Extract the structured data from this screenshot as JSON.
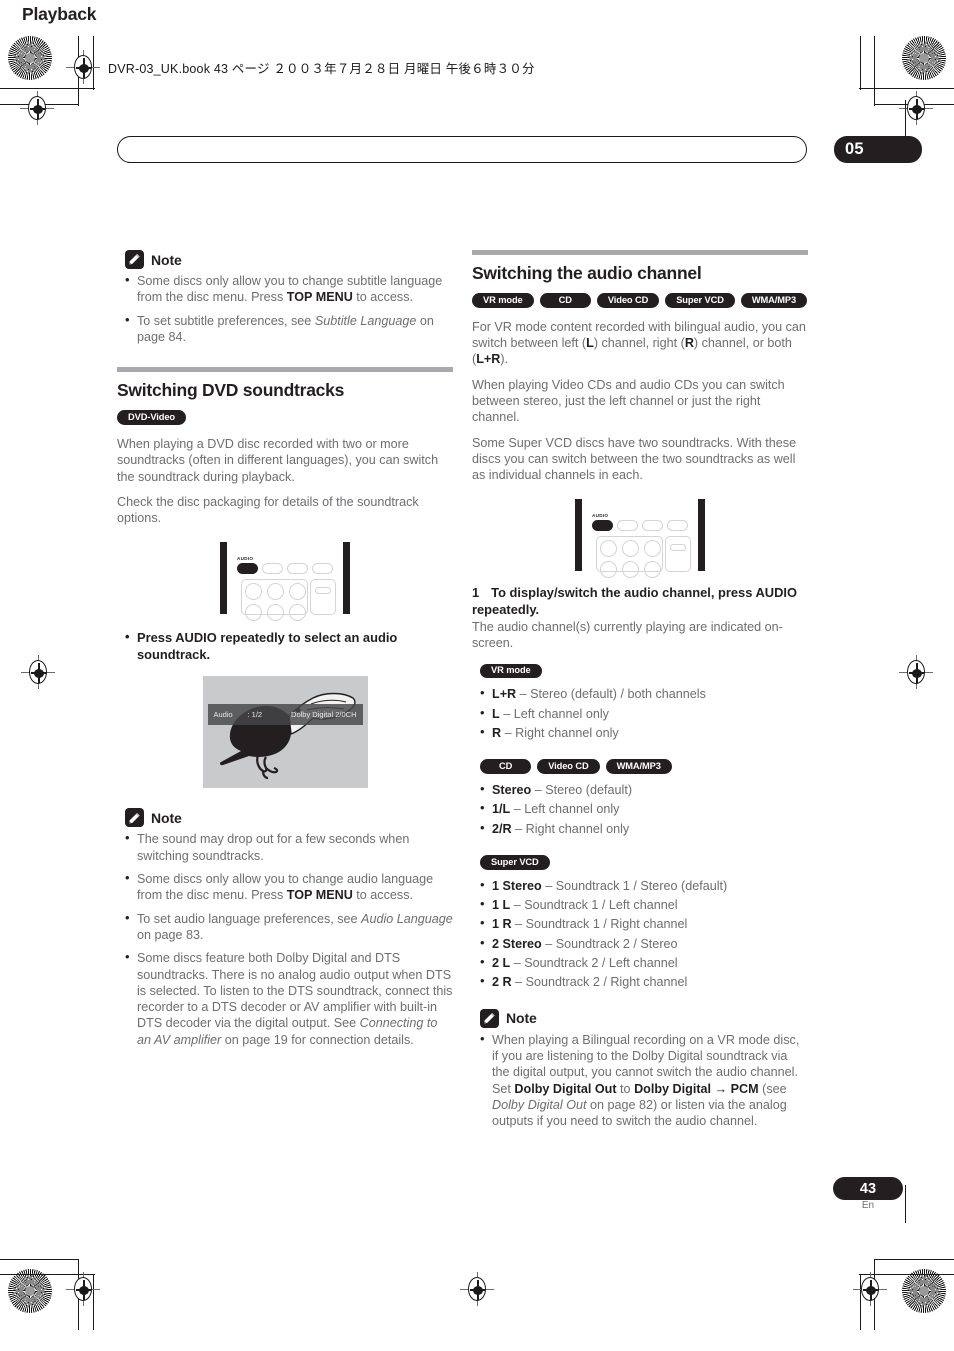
{
  "file_header": "DVR-03_UK.book 43 ページ ２００３年７月２８日 月曜日 午後６時３０分",
  "running_header": {
    "title": "Playback",
    "chapter": "05"
  },
  "footer": {
    "page_number": "43",
    "language": "En"
  },
  "left_column": {
    "note_top": {
      "label": "Note",
      "items": [
        "Some discs only allow you to change subtitle language from the disc menu. Press <b>TOP MENU</b> to access.",
        "To set subtitle preferences, see <i>Subtitle Language</i> on page 84."
      ]
    },
    "section": {
      "heading": "Switching DVD soundtracks",
      "badges": [
        "DVD-Video"
      ],
      "paragraphs": [
        "When playing a DVD disc recorded with two or more soundtracks (often in different languages), you can switch the soundtrack during playback.",
        "Check the disc packaging for details of the soundtrack options."
      ],
      "instruction": "Press AUDIO repeatedly to select an audio soundtrack."
    },
    "osd": {
      "label": "Audio",
      "value": ": 1/2",
      "format": "Dolby Digital 2/0CH"
    },
    "note_bottom": {
      "label": "Note",
      "items": [
        "The sound may drop out for a few seconds when switching soundtracks.",
        "Some discs only allow you to change audio language from the disc menu. Press <b>TOP MENU</b> to access.",
        "To set audio language preferences, see <i>Audio Language</i> on page 83.",
        "Some discs feature both Dolby Digital and DTS soundtracks. There is no analog audio output when DTS is selected. To listen to the DTS soundtrack, connect this recorder to a DTS decoder or AV amplifier with built-in DTS decoder via the digital output. See <i>Connecting to an AV amplifier</i> on page 19 for connection details."
      ]
    }
  },
  "right_column": {
    "section": {
      "heading": "Switching the audio channel",
      "badges": [
        "VR mode",
        "CD",
        "Video CD",
        "Super VCD",
        "WMA/MP3"
      ],
      "paragraphs": [
        "For VR mode content recorded with bilingual audio, you can switch between left (<b>L</b>) channel, right (<b>R</b>) channel, or both (<b>L+R</b>).",
        "When playing Video CDs and audio CDs you can switch between stereo, just the left channel or just the right channel.",
        "Some Super VCD discs have two soundtracks. With these discs you can switch between the two soundtracks as well as individual channels in each."
      ]
    },
    "step": {
      "number": "1",
      "title": "To display/switch the audio channel, press AUDIO repeatedly.",
      "detail": "The audio channel(s) currently playing are indicated on-screen."
    },
    "groups": [
      {
        "badges": [
          "VR mode"
        ],
        "items": [
          "<b>L+R</b> – Stereo (default) / both channels",
          "<b>L</b> – Left channel only",
          "<b>R</b> – Right channel only"
        ]
      },
      {
        "badges": [
          "CD",
          "Video CD",
          "WMA/MP3"
        ],
        "items": [
          "<b>Stereo</b> – Stereo (default)",
          "<b>1/L</b> – Left channel only",
          "<b>2/R</b> – Right channel only"
        ]
      },
      {
        "badges": [
          "Super VCD"
        ],
        "items": [
          "<b>1 Stereo</b> – Soundtrack 1 / Stereo (default)",
          "<b>1 L</b> – Soundtrack 1 / Left channel",
          "<b>1 R</b> – Soundtrack 1 / Right channel",
          "<b>2 Stereo</b> – Soundtrack 2 / Stereo",
          "<b>2 L</b> – Soundtrack 2 / Left channel",
          "<b>2 R</b> – Soundtrack 2 / Right channel"
        ]
      }
    ],
    "note": {
      "label": "Note",
      "items": [
        "When playing a Bilingual recording on a VR mode disc, if you are listening to the Dolby Digital soundtrack via the digital output, you cannot switch the audio channel. Set <b>Dolby Digital Out</b> to <b>Dolby Digital → PCM</b> (see <i>Dolby Digital Out</i> on page 82) or listen via the analog outputs if you need to switch the audio channel."
      ]
    }
  },
  "remote_illustration": {
    "highlighted_button_label": "AUDIO"
  },
  "colors": {
    "ink": "#231f20",
    "body_text": "#6d6e71",
    "rule": "#a7a9ac",
    "osd_background": "#c9cacb"
  }
}
